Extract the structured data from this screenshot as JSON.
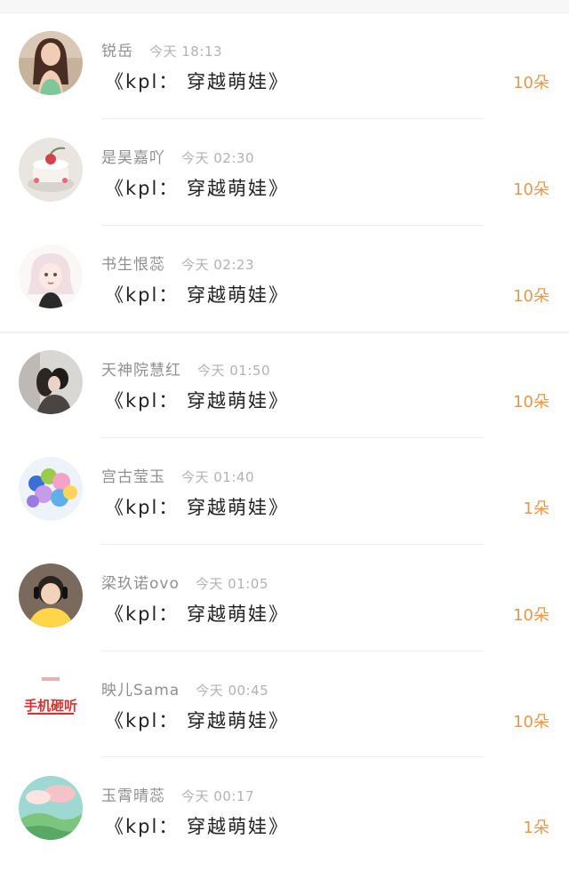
{
  "messages": [
    {
      "user": "锐岳",
      "time": "今天 18:13",
      "text": "《kpl： 穿越萌娃》",
      "gift": "10朵",
      "avatar_icon": "woman-photo-avatar"
    },
    {
      "user": "是昊嘉吖",
      "time": "今天 02:30",
      "text": "《kpl： 穿越萌娃》",
      "gift": "10朵",
      "avatar_icon": "cake-photo-avatar"
    },
    {
      "user": "书生恨蕊",
      "time": "今天 02:23",
      "text": "《kpl： 穿越萌娃》",
      "gift": "10朵",
      "avatar_icon": "anime-girl-avatar"
    },
    {
      "user": "天神院慧红",
      "time": "今天 01:50",
      "text": "《kpl： 穿越萌娃》",
      "gift": "10朵",
      "avatar_icon": "couple-photo-avatar"
    },
    {
      "user": "宫古莹玉",
      "time": "今天 01:40",
      "text": "《kpl： 穿越萌娃》",
      "gift": "1朵",
      "avatar_icon": "balloons-avatar"
    },
    {
      "user": "梁玖诺ovo",
      "time": "今天 01:05",
      "text": "《kpl： 穿越萌娃》",
      "gift": "10朵",
      "avatar_icon": "headphones-gamer-avatar"
    },
    {
      "user": "映儿Sama",
      "time": "今天 00:45",
      "text": "《kpl： 穿越萌娃》",
      "gift": "10朵",
      "avatar_icon": "red-logo-avatar"
    },
    {
      "user": "玉霄晴蕊",
      "time": "今天 00:17",
      "text": "《kpl： 穿越萌娃》",
      "gift": "1朵",
      "avatar_icon": "landscape-painting-avatar"
    }
  ],
  "avatar_logo_text": "手机砸听",
  "colors": {
    "gift": "#e8974a",
    "name": "#8f8f8f",
    "time": "#b2b2b2",
    "message": "#222222"
  }
}
